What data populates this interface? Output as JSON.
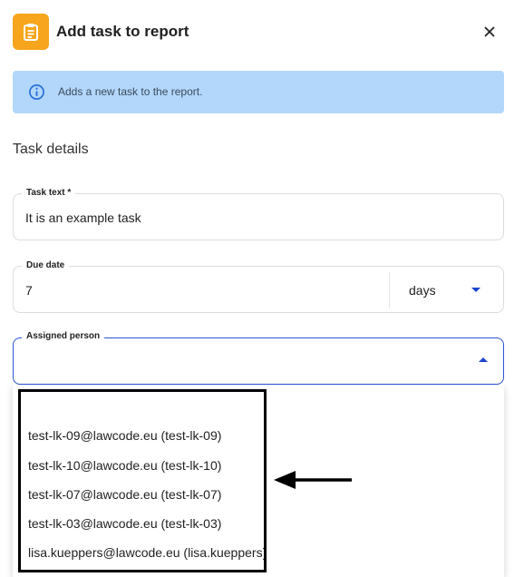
{
  "header": {
    "title": "Add task to report",
    "close_label": "×"
  },
  "banner": {
    "text": "Adds a new task to the report."
  },
  "section": {
    "title": "Task details"
  },
  "task_text": {
    "label": "Task text *",
    "value": "It is an example task"
  },
  "due_date": {
    "label": "Due date",
    "value": "7",
    "unit": "days"
  },
  "assigned_person": {
    "label": "Assigned person",
    "value": "",
    "options": [
      "test-lk-09@lawcode.eu (test-lk-09)",
      "test-lk-10@lawcode.eu (test-lk-10)",
      "test-lk-07@lawcode.eu (test-lk-07)",
      "test-lk-03@lawcode.eu (test-lk-03)",
      "lisa.kueppers@lawcode.eu (lisa.kueppers)"
    ]
  },
  "colors": {
    "accent": "#2a55d6",
    "header_icon": "#f7a51c",
    "banner": "#b3d7fb"
  },
  "icons": {
    "header": "clipboard-icon",
    "banner": "info-icon",
    "close": "close-icon"
  }
}
